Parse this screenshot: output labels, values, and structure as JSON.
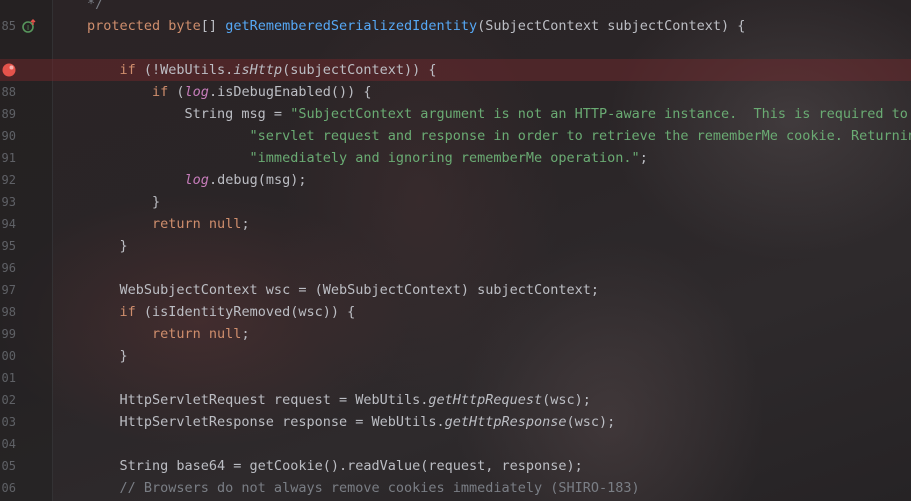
{
  "editor": {
    "lines": [
      {
        "num": "",
        "tokens": [
          {
            "t": "*/",
            "c": "cmt"
          }
        ]
      },
      {
        "num": "85",
        "marker": "implements",
        "tokens": [
          {
            "t": "protected ",
            "c": "kw"
          },
          {
            "t": "byte",
            "c": "kw"
          },
          {
            "t": "[] ",
            "c": "pl"
          },
          {
            "t": "getRememberedSerializedIdentity",
            "c": "fn"
          },
          {
            "t": "(SubjectContext subjectContext) {",
            "c": "pl"
          }
        ]
      },
      {
        "num": "",
        "tokens": []
      },
      {
        "num": "",
        "marker": "breakpoint",
        "highlight": true,
        "tokens": [
          {
            "t": "    if ",
            "c": "kw"
          },
          {
            "t": "(!WebUtils.",
            "c": "pl"
          },
          {
            "t": "isHttp",
            "c": "pl it"
          },
          {
            "t": "(subjectContext)) {",
            "c": "pl"
          }
        ]
      },
      {
        "num": "88",
        "tokens": [
          {
            "t": "        if ",
            "c": "kw"
          },
          {
            "t": "(",
            "c": "pl"
          },
          {
            "t": "log",
            "c": "fld it"
          },
          {
            "t": ".isDebugEnabled()) {",
            "c": "pl"
          }
        ]
      },
      {
        "num": "89",
        "tokens": [
          {
            "t": "            String msg = ",
            "c": "pl"
          },
          {
            "t": "\"SubjectContext argument is not an HTTP-aware instance.  This is required to o",
            "c": "str"
          }
        ]
      },
      {
        "num": "90",
        "tokens": [
          {
            "t": "                    \"servlet request and response in order to retrieve the rememberMe cookie. Returning",
            "c": "str"
          }
        ]
      },
      {
        "num": "91",
        "tokens": [
          {
            "t": "                    \"immediately and ignoring rememberMe operation.\"",
            "c": "str"
          },
          {
            "t": ";",
            "c": "pl"
          }
        ]
      },
      {
        "num": "92",
        "tokens": [
          {
            "t": "            ",
            "c": "pl"
          },
          {
            "t": "log",
            "c": "fld it"
          },
          {
            "t": ".debug(msg);",
            "c": "pl"
          }
        ]
      },
      {
        "num": "93",
        "tokens": [
          {
            "t": "        }",
            "c": "pl"
          }
        ]
      },
      {
        "num": "94",
        "tokens": [
          {
            "t": "        return null",
            "c": "kw"
          },
          {
            "t": ";",
            "c": "pl"
          }
        ]
      },
      {
        "num": "95",
        "tokens": [
          {
            "t": "    }",
            "c": "pl"
          }
        ]
      },
      {
        "num": "96",
        "tokens": []
      },
      {
        "num": "97",
        "tokens": [
          {
            "t": "    WebSubjectContext wsc = (WebSubjectContext) subjectContext;",
            "c": "pl"
          }
        ]
      },
      {
        "num": "98",
        "tokens": [
          {
            "t": "    if ",
            "c": "kw"
          },
          {
            "t": "(isIdentityRemoved(wsc)) {",
            "c": "pl"
          }
        ]
      },
      {
        "num": "99",
        "tokens": [
          {
            "t": "        return null",
            "c": "kw"
          },
          {
            "t": ";",
            "c": "pl"
          }
        ]
      },
      {
        "num": "00",
        "tokens": [
          {
            "t": "    }",
            "c": "pl"
          }
        ]
      },
      {
        "num": "01",
        "tokens": []
      },
      {
        "num": "02",
        "tokens": [
          {
            "t": "    HttpServletRequest request = WebUtils.",
            "c": "pl"
          },
          {
            "t": "getHttpRequest",
            "c": "pl it"
          },
          {
            "t": "(wsc);",
            "c": "pl"
          }
        ]
      },
      {
        "num": "03",
        "tokens": [
          {
            "t": "    HttpServletResponse response = WebUtils.",
            "c": "pl"
          },
          {
            "t": "getHttpResponse",
            "c": "pl it"
          },
          {
            "t": "(wsc);",
            "c": "pl"
          }
        ]
      },
      {
        "num": "04",
        "tokens": []
      },
      {
        "num": "05",
        "tokens": [
          {
            "t": "    String base64 = getCookie().readValue(request, response);",
            "c": "pl"
          }
        ]
      },
      {
        "num": "06",
        "tokens": [
          {
            "t": "    // Browsers do not always remove cookies immediately (SHIRO-183)",
            "c": "cmt"
          }
        ]
      }
    ]
  }
}
